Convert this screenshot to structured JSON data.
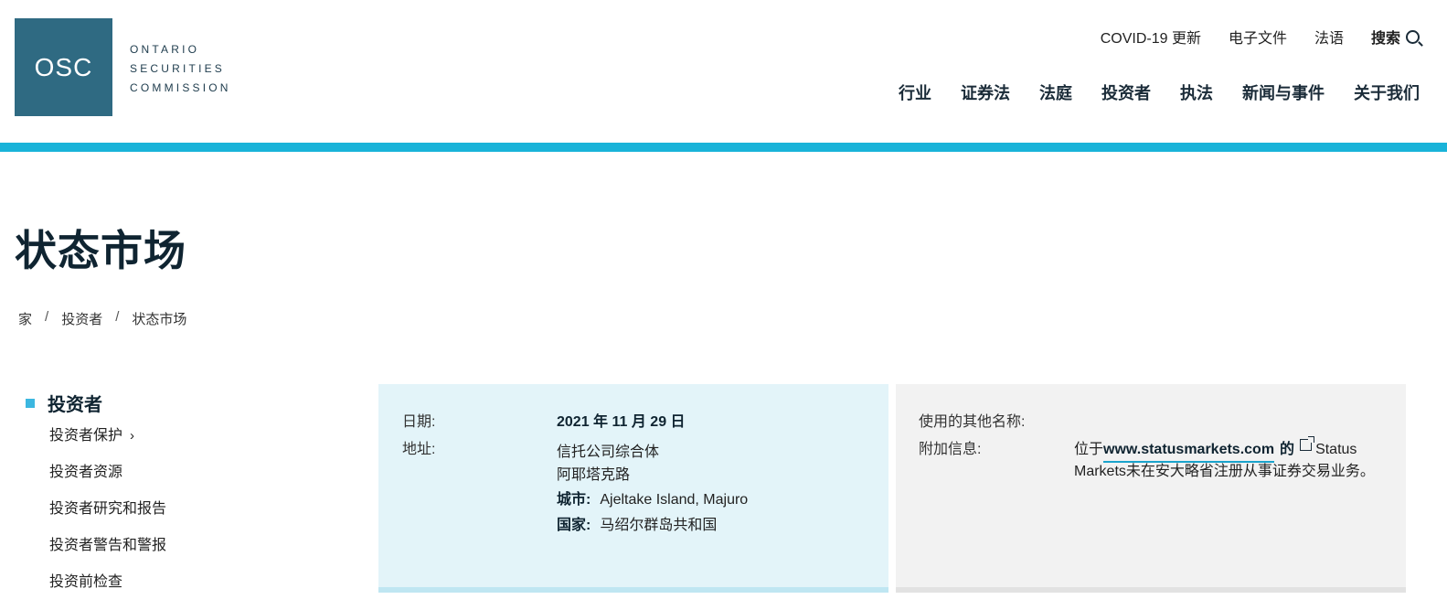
{
  "logo": {
    "abbr": "OSC",
    "line1": "ONTARIO",
    "line2": "SECURITIES",
    "line3": "COMMISSION"
  },
  "utility_nav": {
    "covid": "COVID-19 更新",
    "edocs": "电子文件",
    "french": "法语",
    "search": "搜索"
  },
  "main_nav": [
    "行业",
    "证券法",
    "法庭",
    "投资者",
    "执法",
    "新闻与事件",
    "关于我们"
  ],
  "page": {
    "title": "状态市场"
  },
  "breadcrumb": [
    "家",
    "投资者",
    "状态市场"
  ],
  "sidebar": {
    "heading": "投资者",
    "items": [
      "投资者保护",
      "投资者资源",
      "投资者研究和报告",
      "投资者警告和警报",
      "投资前检查"
    ]
  },
  "details": {
    "date_label": "日期:",
    "date_value": "2021 年 11 月 29 日",
    "address_label": "地址:",
    "address_line1": "信托公司综合体",
    "address_line2": "阿耶塔克路",
    "city_label": "城市:",
    "city_value": "Ajeltake Island, Majuro",
    "country_label": "国家:",
    "country_value": "马绍尔群岛共和国"
  },
  "extra": {
    "aliases_label": "使用的其他名称:",
    "additional_label": "附加信息:",
    "info_prefix": "位于",
    "info_url": "www.statusmarkets.com",
    "info_of": "的",
    "info_line1_suffix": "Status",
    "info_line2": "Markets未在安大略省注册从事证券交易业务。"
  },
  "colors": {
    "accent_bar": "#19b3d9",
    "logo_bg": "#2f6a82",
    "card_left_bg": "#e3f4f9",
    "card_right_bg": "#f2f2f2"
  }
}
